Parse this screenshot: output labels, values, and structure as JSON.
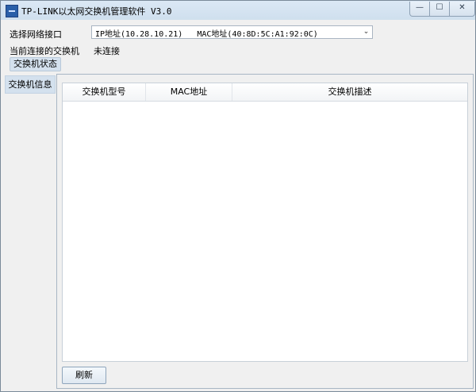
{
  "window": {
    "title": "TP-LINK以太网交换机管理软件 V3.0",
    "controls": {
      "minimize": "—",
      "maximize": "☐",
      "close": "✕"
    }
  },
  "network": {
    "label": "选择网络接口",
    "selected": "IP地址(10.28.10.21)   MAC地址(40:8D:5C:A1:92:0C)"
  },
  "connection": {
    "label": "当前连接的交换机",
    "value": "未连接"
  },
  "tabs": {
    "status": "交换机状态"
  },
  "sidebar": {
    "items": [
      {
        "label": "交换机信息"
      }
    ]
  },
  "table": {
    "columns": [
      "交换机型号",
      "MAC地址",
      "交换机描述"
    ],
    "rows": []
  },
  "actions": {
    "refresh": "刷新"
  },
  "colors": {
    "titlebar": "#d6e4f2",
    "accent": "#d4e1ee"
  },
  "icons": {
    "app": "tp-link-app-icon",
    "dropdown": "chevron-down-icon"
  }
}
